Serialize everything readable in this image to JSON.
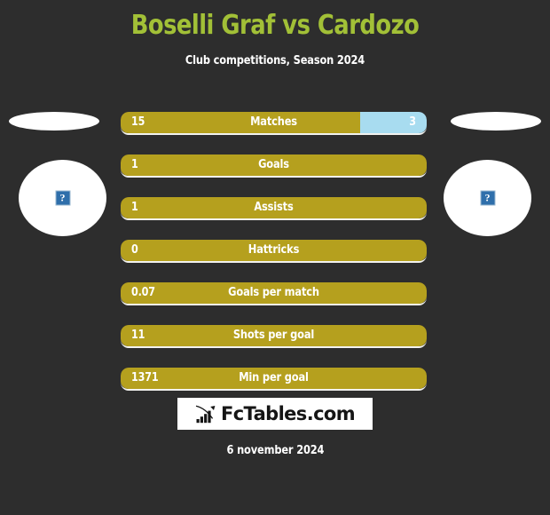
{
  "page": {
    "background_color": "#2d2d2d",
    "title": "Boselli Graf vs Cardozo",
    "title_color": "#a2c037",
    "subtitle": "Club competitions, Season 2024"
  },
  "players": {
    "home": {
      "avatar_alt": "?"
    },
    "away": {
      "avatar_alt": "?"
    }
  },
  "colors": {
    "home_bar": "#b5a01e",
    "away_bar": "#a8dcf0",
    "accent": "#a2c037",
    "text": "#ffffff"
  },
  "chart_data": {
    "type": "bar",
    "title": "Boselli Graf vs Cardozo",
    "subtitle": "Club competitions, Season 2024",
    "categories": [
      "Matches",
      "Goals",
      "Assists",
      "Hattricks",
      "Goals per match",
      "Shots per goal",
      "Min per goal"
    ],
    "series": [
      {
        "name": "Boselli Graf",
        "color": "#b5a01e",
        "values": [
          15,
          1,
          1,
          0,
          0.07,
          11,
          1371
        ]
      },
      {
        "name": "Cardozo",
        "color": "#a8dcf0",
        "values": [
          3,
          null,
          null,
          null,
          null,
          null,
          null
        ]
      }
    ],
    "legend": "none",
    "grid": false
  },
  "stats": [
    {
      "label": "Matches",
      "home": "15",
      "away": "3",
      "home_pct": 78.3,
      "away_pct": 21.7
    },
    {
      "label": "Goals",
      "home": "1",
      "away": "",
      "home_pct": 100,
      "away_pct": 0
    },
    {
      "label": "Assists",
      "home": "1",
      "away": "",
      "home_pct": 100,
      "away_pct": 0
    },
    {
      "label": "Hattricks",
      "home": "0",
      "away": "",
      "home_pct": 100,
      "away_pct": 0
    },
    {
      "label": "Goals per match",
      "home": "0.07",
      "away": "",
      "home_pct": 100,
      "away_pct": 0
    },
    {
      "label": "Shots per goal",
      "home": "11",
      "away": "",
      "home_pct": 100,
      "away_pct": 0
    },
    {
      "label": "Min per goal",
      "home": "1371",
      "away": "",
      "home_pct": 100,
      "away_pct": 0
    }
  ],
  "logo": {
    "text": "FcTables.com",
    "icon": "bar-chart-icon"
  },
  "footer": {
    "date": "6 november 2024"
  }
}
